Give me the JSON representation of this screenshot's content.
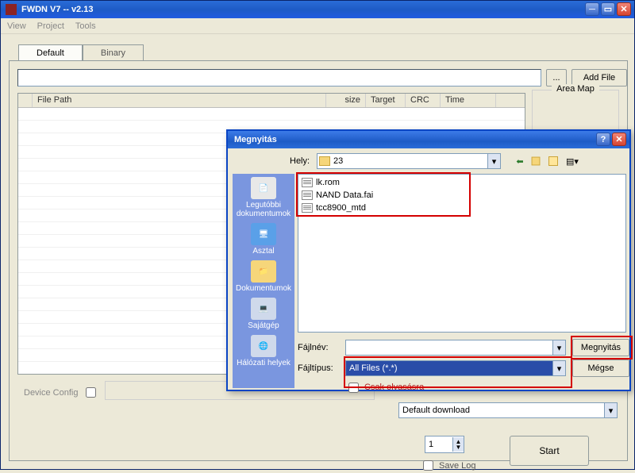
{
  "main": {
    "title": "FWDN V7 -- v2.13",
    "menus": [
      "View",
      "Project",
      "Tools"
    ],
    "tabs": [
      "Default",
      "Binary"
    ],
    "browse_btn": "...",
    "addfile_btn": "Add File",
    "table_headers": [
      "",
      "File Path",
      "size",
      "Target",
      "CRC",
      "Time"
    ],
    "areamap_title": "Area Map",
    "device_config_label": "Device Config",
    "download_dd": "Default download",
    "spin_value": "1",
    "savelog_label": "Save Log",
    "start_btn": "Start"
  },
  "dialog": {
    "title": "Megnyitás",
    "hely_label": "Hely:",
    "hely_value": "23",
    "toolbar_icons": [
      "back-icon",
      "up-icon",
      "newfolder-icon",
      "views-icon"
    ],
    "places": [
      {
        "label": "Legutóbbi dokumentumok",
        "icon": "recent"
      },
      {
        "label": "Asztal",
        "icon": "desktop"
      },
      {
        "label": "Dokumentumok",
        "icon": "documents"
      },
      {
        "label": "Sajátgép",
        "icon": "mycomputer"
      },
      {
        "label": "Hálózati helyek",
        "icon": "network"
      }
    ],
    "files": [
      {
        "name": "lk.rom"
      },
      {
        "name": "NAND Data.fai"
      },
      {
        "name": "tcc8900_mtd"
      }
    ],
    "filename_label": "Fájlnév:",
    "filetype_label": "Fájltípus:",
    "filetype_value": "All Files (*.*)",
    "open_btn": "Megnyitás",
    "cancel_btn": "Mégse",
    "readonly_label": "Csak olvasásra"
  }
}
